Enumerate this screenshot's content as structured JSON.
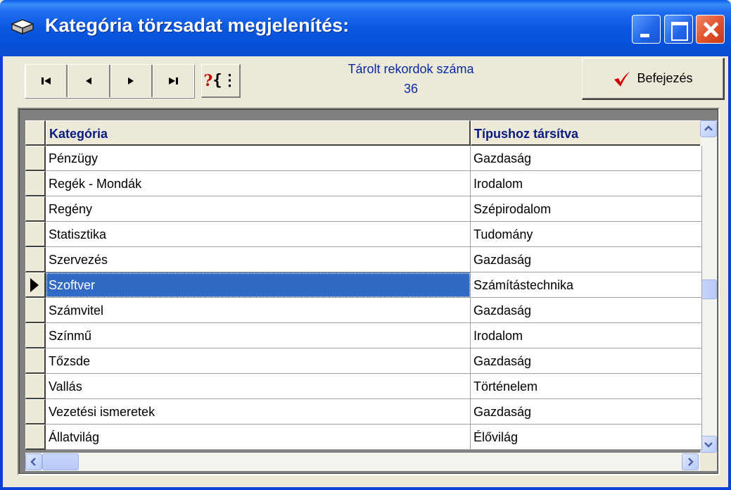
{
  "window": {
    "title": "Kategória törzsadat megjelenítés:",
    "icon": "book-icon"
  },
  "toolbar": {
    "nav_buttons": [
      "first-record",
      "previous-record",
      "next-record",
      "last-record"
    ],
    "help_label": "?",
    "stored_label": "Tárolt rekordok száma",
    "stored_count": "36",
    "finish_label": "Befejezés"
  },
  "grid": {
    "columns": [
      "Kategória",
      "Típushoz társítva"
    ],
    "rows": [
      [
        "Pénzügy",
        "Gazdaság"
      ],
      [
        "Regék - Mondák",
        "Irodalom"
      ],
      [
        "Regény",
        "Szépirodalom"
      ],
      [
        "Statisztika",
        "Tudomány"
      ],
      [
        "Szervezés",
        "Gazdaság"
      ],
      [
        "Szoftver",
        "Számítástechnika"
      ],
      [
        "Számvitel",
        "Gazdaság"
      ],
      [
        "Színmű",
        "Irodalom"
      ],
      [
        "Tőzsde",
        "Gazdaság"
      ],
      [
        "Vallás",
        "Történelem"
      ],
      [
        "Vezetési ismeretek",
        "Gazdaság"
      ],
      [
        "Állatvilág",
        "Élővilág"
      ]
    ],
    "selected_row": 5
  },
  "colors": {
    "title_bar": "#0a58e0",
    "selection": "#316ac5",
    "header_text": "#0a1a80",
    "finish_check": "#d00000"
  }
}
